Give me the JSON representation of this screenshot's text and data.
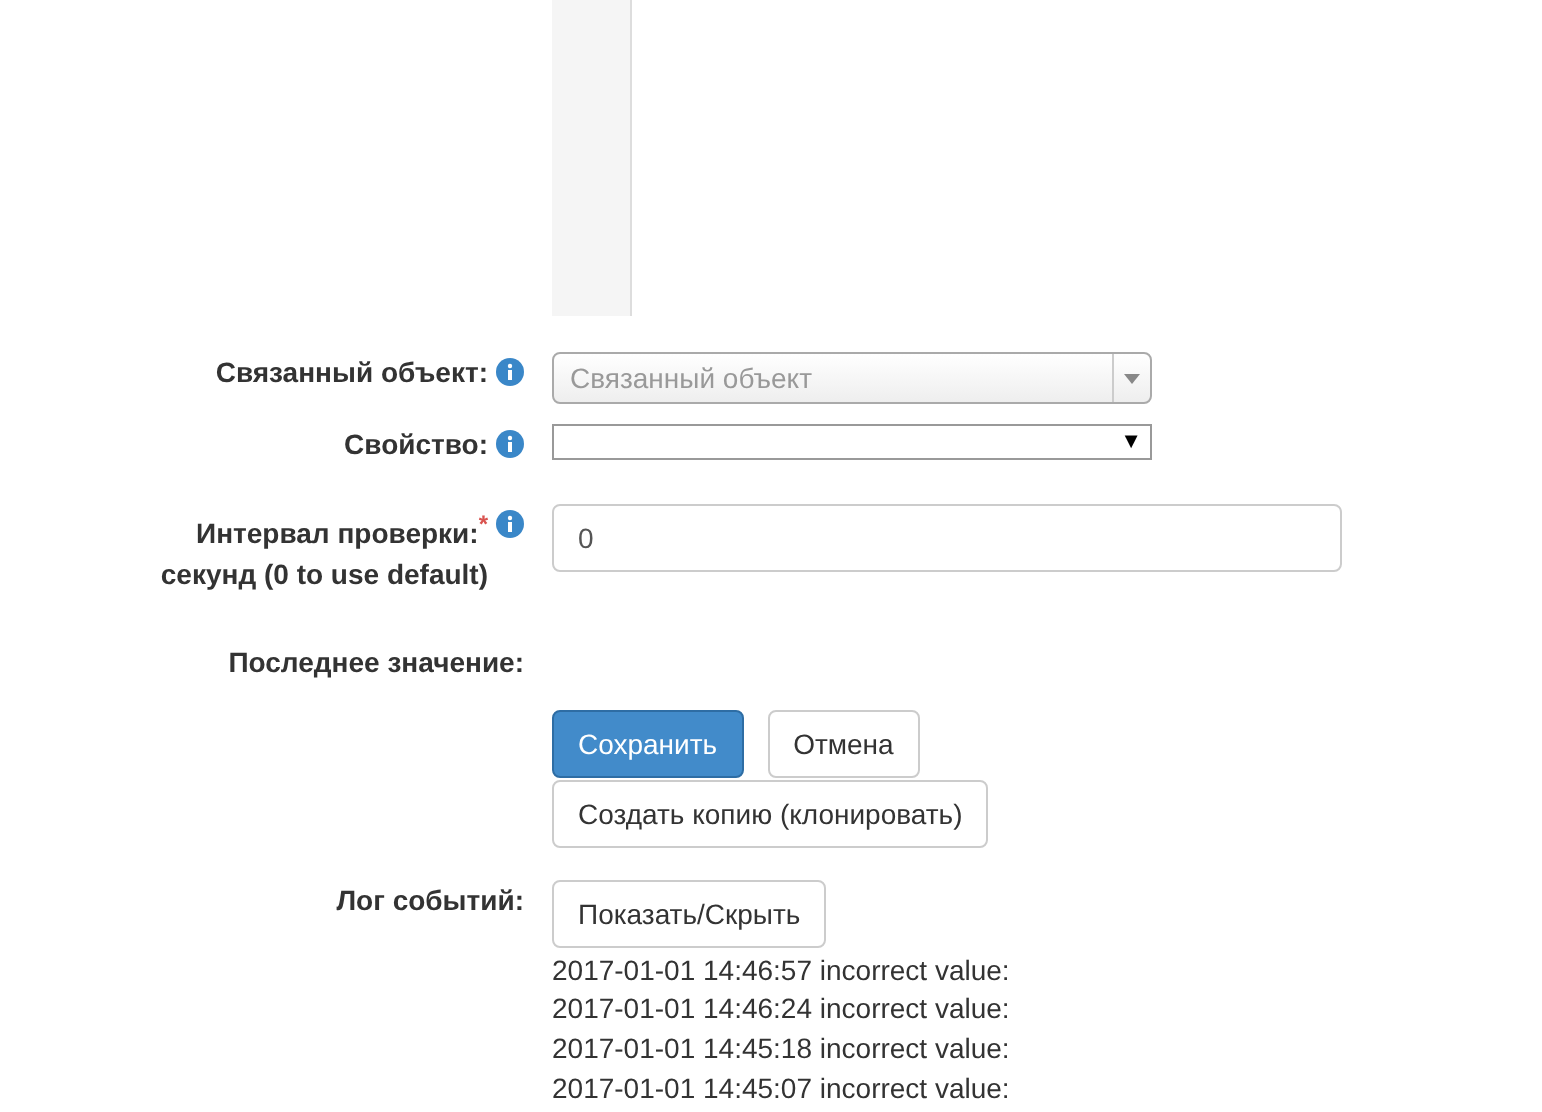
{
  "fields": [
    {
      "kind": "combo",
      "label": "Связанный объект:",
      "required": false,
      "info": true,
      "placeholder": "Связанный объект"
    },
    {
      "kind": "select",
      "label": "Свойство:",
      "required": false,
      "info": true,
      "caret": "▼"
    },
    {
      "kind": "input",
      "label": "Интервал проверки:",
      "sublabel": "секунд (0 to use default)",
      "required": true,
      "required_mark": "*",
      "info": true,
      "value": "0"
    },
    {
      "kind": "static",
      "label": "Последнее значение:",
      "required": false,
      "info": false
    }
  ],
  "actions": [
    {
      "label": "Сохранить",
      "primary": true
    },
    {
      "label": "Отмена",
      "primary": false
    },
    {
      "label": "Создать копию (клонировать)",
      "primary": false
    }
  ],
  "event_log": {
    "label": "Лог событий:",
    "toggle": "Показать/Скрыть",
    "entries": [
      "2017-01-01 14:46:57 incorrect value:",
      "2017-01-01 14:46:24 incorrect value:",
      "2017-01-01 14:45:18 incorrect value:",
      "2017-01-01 14:45:07 incorrect value:"
    ]
  }
}
